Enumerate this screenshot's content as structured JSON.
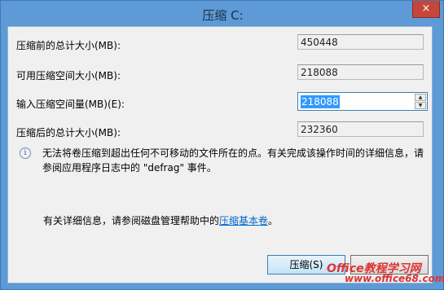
{
  "window": {
    "title": "压缩 C:",
    "close_glyph": "×"
  },
  "fields": [
    {
      "label": "压缩前的总计大小(MB):",
      "value": "450448"
    },
    {
      "label": "可用压缩空间大小(MB):",
      "value": "218088"
    },
    {
      "label": "输入压缩空间量(MB)(E):",
      "value": "218088"
    },
    {
      "label": "压缩后的总计大小(MB):",
      "value": "232360"
    }
  ],
  "info": {
    "icon": "info-icon",
    "text": "无法将卷压缩到超出任何不可移动的文件所在的点。有关完成该操作时间的详细信息，请参阅应用程序日志中的 \"defrag\" 事件。"
  },
  "help": {
    "prefix": "有关详细信息，请参阅磁盘管理帮助中的",
    "link": "压缩基本卷",
    "suffix": "。"
  },
  "buttons": {
    "shrink": "压缩(S)"
  },
  "watermark": {
    "line1": "Office教程学习网",
    "line2": "www.office68.com"
  }
}
